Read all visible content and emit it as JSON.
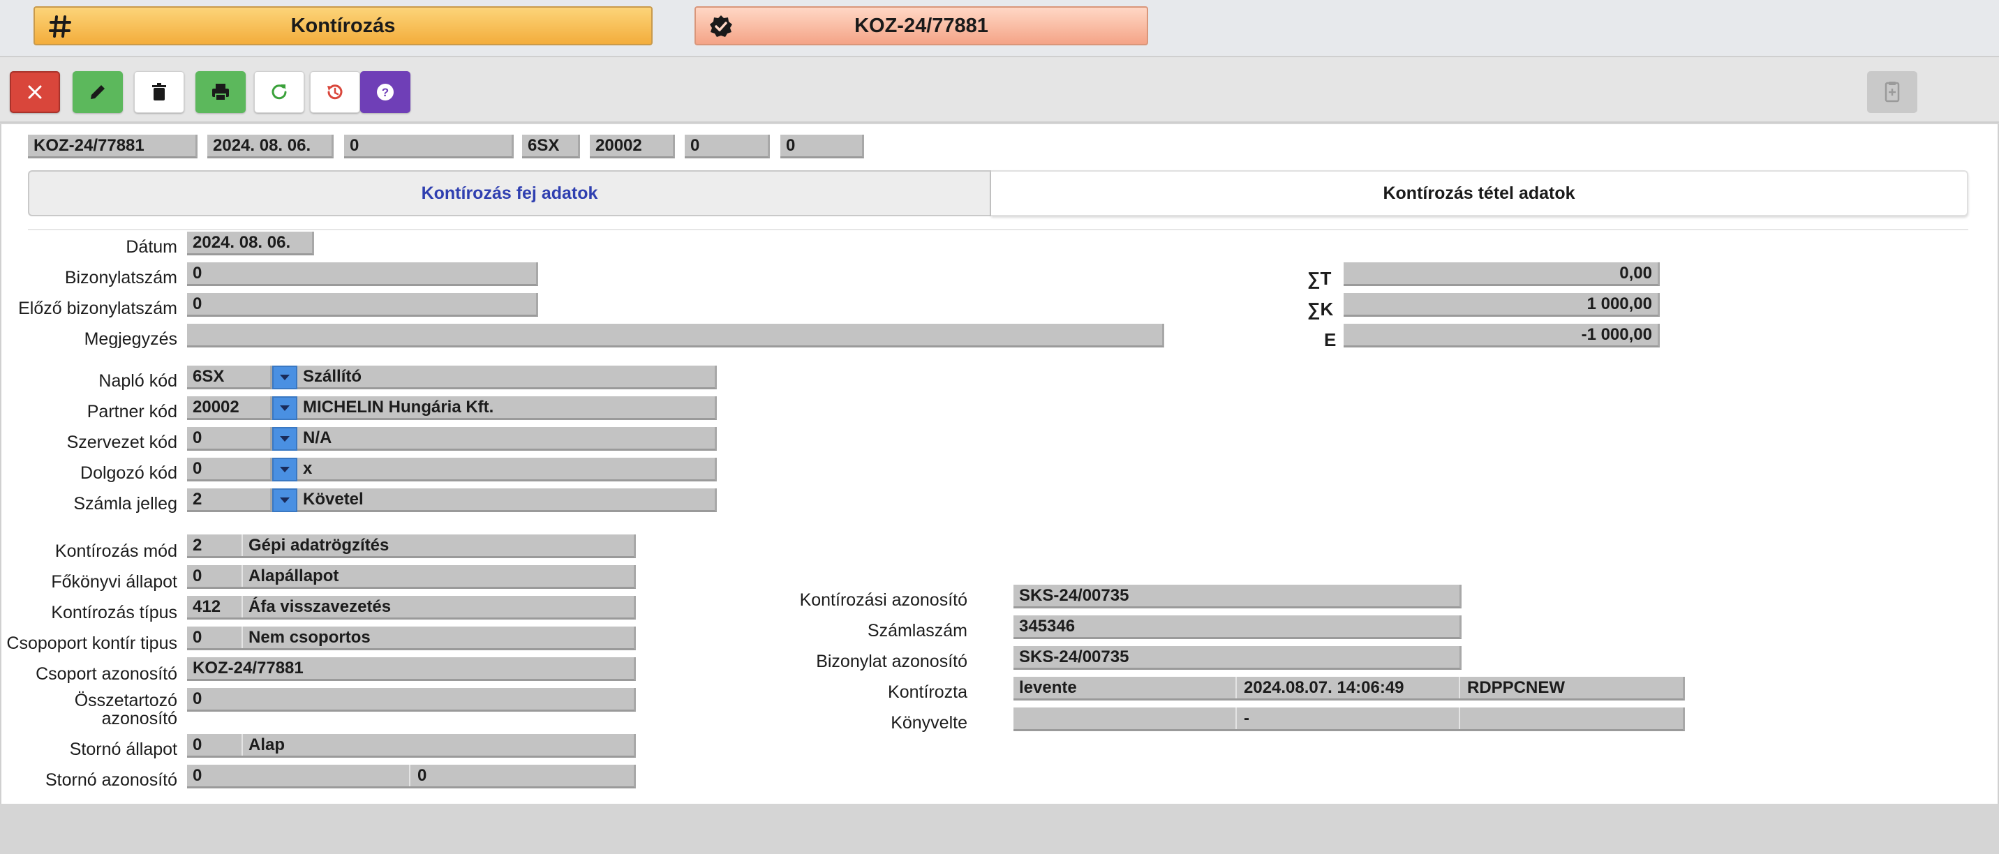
{
  "header": {
    "module_title": "Kontírozás",
    "record_title": "KOZ-24/77881"
  },
  "toolbar": {
    "buttons": [
      {
        "name": "close-button",
        "icon": "close-icon",
        "color": "#d9463b"
      },
      {
        "name": "edit-button",
        "icon": "pencil-icon",
        "color": "#5cb85c"
      },
      {
        "name": "delete-button",
        "icon": "trash-icon",
        "color": "#ffffff"
      },
      {
        "name": "print-button",
        "icon": "print-icon",
        "color": "#5cb85c"
      },
      {
        "name": "refresh-button",
        "icon": "refresh-icon",
        "color": "#ffffff"
      },
      {
        "name": "revert-button",
        "icon": "history-icon",
        "color": "#ffffff"
      },
      {
        "name": "help-button",
        "icon": "help-icon",
        "color": "#6f3fb7"
      }
    ],
    "side_button_icon": "document-add-icon"
  },
  "summary": {
    "doc_id": "KOZ-24/77881",
    "date": "2024. 08. 06.",
    "number": "0",
    "journal": "6SX",
    "partner": "20002",
    "org": "0",
    "employee": "0"
  },
  "tabs": {
    "header_tab": "Kontírozás fej adatok",
    "items_tab": "Kontírozás tétel adatok"
  },
  "form": {
    "datum": {
      "label": "Dátum",
      "value": "2024. 08. 06."
    },
    "bizonylatszam": {
      "label": "Bizonylatszám",
      "value": "0"
    },
    "elozo": {
      "label": "Előző bizonylatszám",
      "value": "0"
    },
    "megjegyzes": {
      "label": "Megjegyzés",
      "value": ""
    },
    "naplo": {
      "label": "Napló kód",
      "code": "6SX",
      "name": "Szállító"
    },
    "partner": {
      "label": "Partner kód",
      "code": "20002",
      "name": "MICHELIN Hungária Kft."
    },
    "szervezet": {
      "label": "Szervezet kód",
      "code": "0",
      "name": "N/A"
    },
    "dolgozo": {
      "label": "Dolgozó kód",
      "code": "0",
      "name": "x"
    },
    "szamla_jelleg": {
      "label": "Számla jelleg",
      "code": "2",
      "name": "Követel"
    },
    "kontir_mod": {
      "label": "Kontírozás mód",
      "code": "2",
      "name": "Gépi adatrögzítés"
    },
    "fokonyvi": {
      "label": "Főkönyvi állapot",
      "code": "0",
      "name": "Alapállapot"
    },
    "kontir_tipus": {
      "label": "Kontírozás típus",
      "code": "412",
      "name": "Áfa visszavezetés"
    },
    "csop_tipus": {
      "label": "Csopoport kontír tipus",
      "code": "0",
      "name": "Nem csoportos"
    },
    "csop_azon": {
      "label": "Csoport azonosító",
      "value": "KOZ-24/77881"
    },
    "osszetartozo": {
      "label_1": "Összetartozó",
      "label_2": "azonosító",
      "value": "0"
    },
    "storno_allapot": {
      "label": "Stornó állapot",
      "code": "0",
      "name": "Alap"
    },
    "storno_azon": {
      "label": "Stornó azonosító",
      "value_1": "0",
      "value_2": "0"
    }
  },
  "totals": {
    "t": {
      "label": "∑T",
      "value": "0,00"
    },
    "k": {
      "label": "∑K",
      "value": "1 000,00"
    },
    "e": {
      "label": "E",
      "value": "-1 000,00"
    }
  },
  "right": {
    "kontir_azon": {
      "label": "Kontírozási azonosító",
      "value": "SKS-24/00735"
    },
    "szamlaszam": {
      "label": "Számlaszám",
      "value": "345346"
    },
    "bizonylat_azon": {
      "label": "Bizonylat azonosító",
      "value": "SKS-24/00735"
    },
    "kontirozta": {
      "label": "Kontírozta",
      "user": "levente",
      "time": "2024.08.07. 14:06:49",
      "machine": "RDPPCNEW"
    },
    "konyvelte": {
      "label": "Könyvelte",
      "user": "",
      "time": "-",
      "machine": ""
    }
  }
}
